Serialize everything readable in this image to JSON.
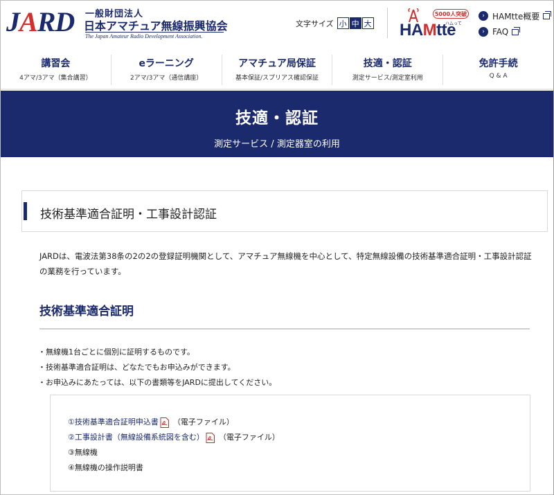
{
  "header": {
    "logo": {
      "jard": "JARD",
      "line1": "一般財団法人",
      "line2": "日本アマチュア無線振興協会",
      "line3": "The Japan Amateur Radio Development Association."
    },
    "font_size": {
      "label": "文字サイズ",
      "small": "小",
      "medium": "中",
      "large": "大",
      "selected": "中"
    },
    "hamtte": {
      "badge": "5000人突破",
      "word_a": "HA",
      "word_b": "M",
      "word_c": "tte",
      "ruby": "ハムって"
    },
    "links": [
      {
        "label": "HAMtte概要"
      },
      {
        "label": "FAQ"
      }
    ]
  },
  "nav": [
    {
      "title": "講習会",
      "sub": "4アマ/3アマ（集合講習）"
    },
    {
      "title": "eラーニング",
      "sub": "2アマ/3アマ（通信講座）"
    },
    {
      "title": "アマチュア局保証",
      "sub": "基本保証/スプリアス確認保証"
    },
    {
      "title": "技適・認証",
      "sub": "測定サービス/測定室利用"
    },
    {
      "title": "免許手続",
      "sub": "Q & A"
    }
  ],
  "hero": {
    "title": "技適・認証",
    "subtitle": "測定サービス / 測定器室の利用"
  },
  "main": {
    "section_title": "技術基準適合証明・工事設計認証",
    "intro": "JARDは、電波法第38条の2の2の登録証明機関として、アマチュア無線機を中心として、特定無線設備の技術基準適合証明・工事設計認証の業務を行っています。",
    "subsection_title": "技術基準適合証明",
    "bullets": [
      "・無線機1台ごとに個別に証明するものです。",
      "・技術基準適合証明は、どなたでもお申込みができます。",
      "・お申込みにあたっては、以下の書類等をJARDに提出してください。"
    ],
    "documents": [
      {
        "label": "①技術基準適合証明申込書",
        "note": "（電子ファイル）"
      },
      {
        "label": "②工事設計書（無線設備系統図を含む）",
        "note": "（電子ファイル）"
      },
      {
        "label": "③無線機"
      },
      {
        "label": "④無線機の操作説明書"
      }
    ]
  },
  "colors": {
    "brand_navy": "#1a2a6c",
    "accent_red": "#d32f2f"
  }
}
